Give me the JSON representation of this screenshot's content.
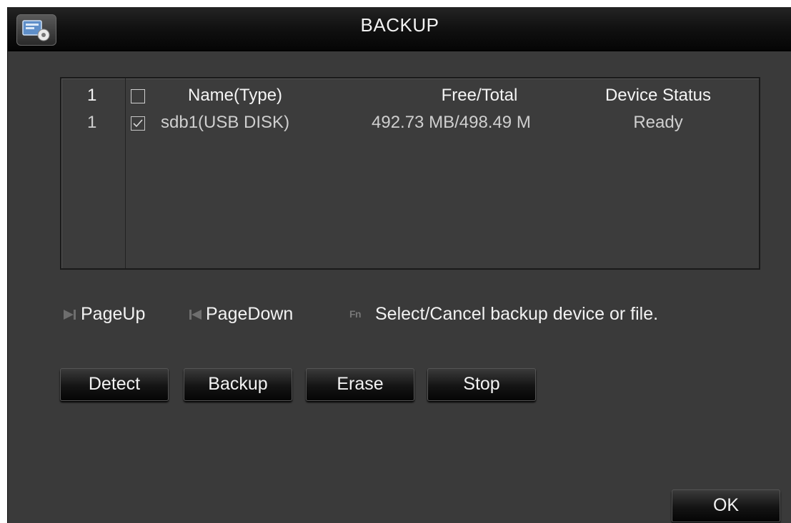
{
  "window": {
    "title": "BACKUP",
    "icon": "backup-settings-icon"
  },
  "table": {
    "headers": {
      "index": "1",
      "name": "Name(Type)",
      "free_total": "Free/Total",
      "status": "Device Status"
    },
    "rows": [
      {
        "index": "1",
        "checked": true,
        "name": "sdb1(USB DISK)",
        "free_total": "492.73 MB/498.49 M",
        "status": "Ready"
      }
    ]
  },
  "hints": {
    "page_up": "PageUp",
    "page_down": "PageDown",
    "fn_key": "Fn",
    "select": "Select/Cancel backup device or file."
  },
  "buttons": {
    "detect": "Detect",
    "backup": "Backup",
    "erase": "Erase",
    "stop": "Stop",
    "ok": "OK"
  },
  "colors": {
    "background": "#3a3a3a",
    "titlebar": "#111111",
    "text": "#f2f2f2"
  }
}
